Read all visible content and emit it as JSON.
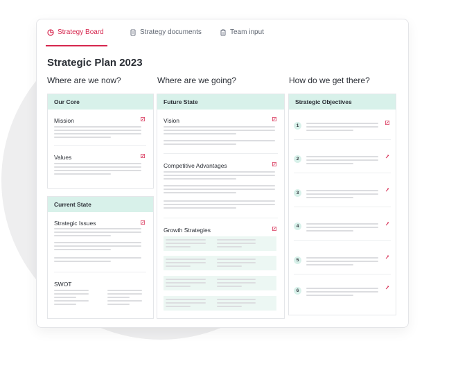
{
  "tabs": [
    {
      "label": "Strategy Board",
      "icon": "pie-chart-icon",
      "active": true
    },
    {
      "label": "Strategy documents",
      "icon": "document-icon",
      "active": false
    },
    {
      "label": "Team input",
      "icon": "clipboard-icon",
      "active": false
    }
  ],
  "page": {
    "title": "Strategic Plan 2023"
  },
  "columns": [
    {
      "heading": "Where are we now?"
    },
    {
      "heading": "Where are we going?"
    },
    {
      "heading": "How do we get there?"
    }
  ],
  "panels": {
    "our_core": {
      "title": "Our Core",
      "sections": [
        "Mission",
        "Values"
      ]
    },
    "current_state": {
      "title": "Current State",
      "sections": [
        "Strategic Issues",
        "SWOT"
      ]
    },
    "future_state": {
      "title": "Future State",
      "sections": [
        "Vision",
        "Competitive Advantages",
        "Growth Strategies"
      ]
    },
    "objectives": {
      "title": "Strategic Objectives",
      "numbers": [
        "1",
        "2",
        "3",
        "4",
        "5",
        "6"
      ]
    }
  },
  "colors": {
    "accent": "#d6264e",
    "panel_header": "#d8f1ea",
    "placeholder_line": "#dcdde0",
    "background_circle": "#eeeeef"
  }
}
